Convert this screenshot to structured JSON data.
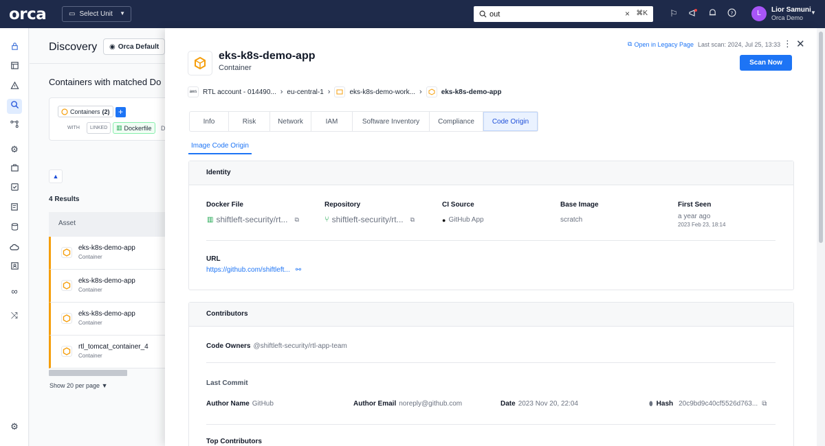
{
  "topbar": {
    "logo": "orca",
    "unit_select": "Select Unit",
    "search_value": "out",
    "search_clear": "×",
    "search_shortcut": "⌘K",
    "user_name": "Lior Samuni",
    "user_org": "Orca Demo",
    "avatar_initial": "L"
  },
  "discovery": {
    "title": "Discovery",
    "view_button": "Orca Default",
    "query_title": "Containers with matched Do",
    "chip_containers": "Containers",
    "chip_count": "(2)",
    "chip_with": "WITH",
    "chip_linked": "LINKED",
    "chip_dockerfile": "Dockerfile",
    "chip_more": "D",
    "results_count": "4 Results",
    "col_asset": "Asset",
    "rows": [
      {
        "name": "eks-k8s-demo-app",
        "type": "Container"
      },
      {
        "name": "eks-k8s-demo-app",
        "type": "Container"
      },
      {
        "name": "eks-k8s-demo-app",
        "type": "Container"
      },
      {
        "name": "rtl_tomcat_container_4",
        "type": "Container"
      }
    ],
    "per_page": "Show 20 per page"
  },
  "drawer": {
    "title": "eks-k8s-demo-app",
    "subtitle": "Container",
    "legacy_link": "Open in Legacy Page",
    "last_scan": "Last scan: 2024, Jul 25, 13:33",
    "scan_now": "Scan Now",
    "breadcrumbs": [
      "RTL account - 014490...",
      "eu-central-1",
      "eks-k8s-demo-work...",
      "eks-k8s-demo-app"
    ],
    "tabs": [
      "Info",
      "Risk",
      "Network",
      "IAM",
      "Software Inventory",
      "Compliance",
      "Code Origin"
    ],
    "active_tab": "Code Origin",
    "subtab": "Image Code Origin",
    "identity": {
      "heading": "Identity",
      "docker_file_label": "Docker File",
      "docker_file_value": "shiftleft-security/rt...",
      "repository_label": "Repository",
      "repository_value": "shiftleft-security/rt...",
      "ci_source_label": "CI Source",
      "ci_source_value": "GitHub App",
      "base_image_label": "Base Image",
      "base_image_value": "scratch",
      "first_seen_label": "First Seen",
      "first_seen_value": "a year ago",
      "first_seen_date": "2023 Feb 23, 18:14",
      "url_label": "URL",
      "url_value": "https://github.com/shiftleft..."
    },
    "contributors": {
      "heading": "Contributors",
      "code_owners_label": "Code Owners",
      "code_owners_value": "@shiftleft-security/rtl-app-team",
      "last_commit_label": "Last Commit",
      "author_name_label": "Author Name",
      "author_name_value": "GitHub",
      "author_email_label": "Author Email",
      "author_email_value": "noreply@github.com",
      "date_label": "Date",
      "date_value": "2023 Nov 20, 22:04",
      "hash_label": "Hash",
      "hash_value": "20c9bd9c40cf5526d763...",
      "top_contributors_label": "Top Contributors"
    }
  },
  "colors": {
    "topbar": "#1e2a4a",
    "accent": "#1d74f5",
    "asset_orange": "#f59e0b",
    "avatar": "#a855f7"
  }
}
